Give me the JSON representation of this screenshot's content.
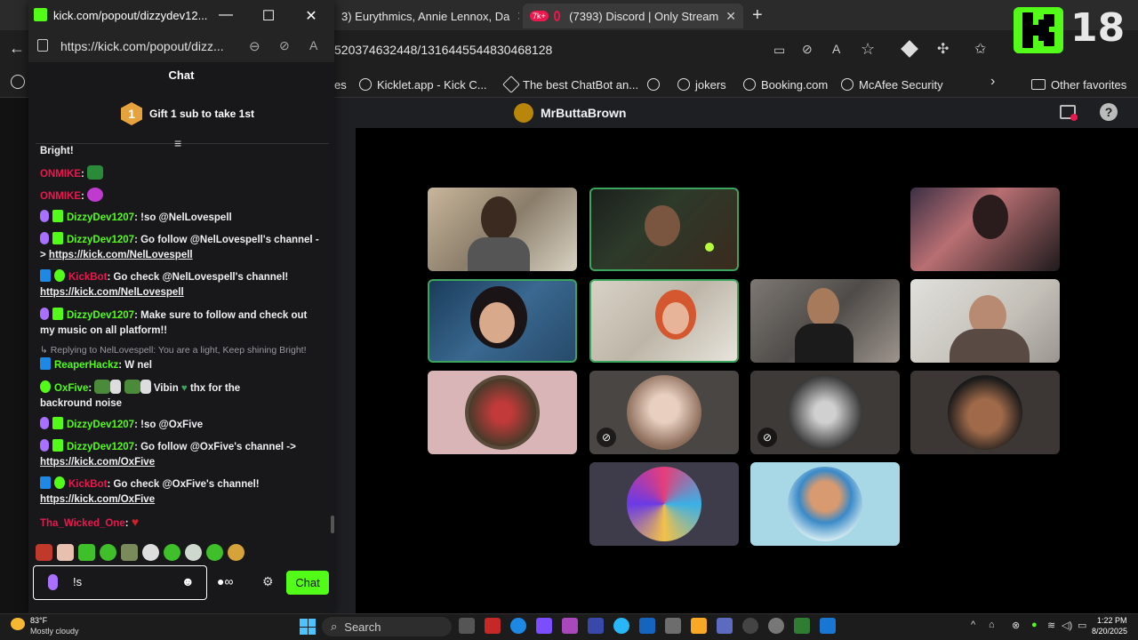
{
  "bg_browser": {
    "tabs": [
      {
        "label": "3) Eurythmics, Annie Lennox, Da"
      },
      {
        "label": "(7393) Discord | Only Stream",
        "badge": "7k+"
      }
    ],
    "url": "520374632448/1316445544830468128",
    "bookmarks": [
      "es",
      "Kicklet.app - Kick C...",
      "The best ChatBot an...",
      "jokers",
      "Booking.com",
      "McAfee Security"
    ],
    "other_favorites": "Other favorites"
  },
  "discord": {
    "channel_name": "MrButtaBrown"
  },
  "overlay": {
    "age_rating": "18"
  },
  "popout": {
    "window_title": "kick.com/popout/dizzydev12...",
    "url": "https://kick.com/popout/dizz...",
    "chat_title": "Chat",
    "gift_badge": "1",
    "gift_text": "Gift 1 sub to take 1st",
    "messages": [
      {
        "user": "",
        "text": "Bright!"
      },
      {
        "user": "ONMIKE",
        "sep": ":"
      },
      {
        "user": "ONMIKE",
        "sep": ":"
      },
      {
        "user": "DizzyDev1207",
        "sep": ":",
        "text": " !so @NelLovespell"
      },
      {
        "user": "DizzyDev1207",
        "sep": ":",
        "text": " Go follow @NelLovespell's channel -",
        "text2": "> ",
        "link": "https://kick.com/NelLovespell"
      },
      {
        "user": "KickBot",
        "sep": ":",
        "text": " Go check @NelLovespell's channel!",
        "link": "https://kick.com/NelLovespell"
      },
      {
        "user": "DizzyDev1207",
        "sep": ":",
        "text": " Make sure to follow and check out",
        "text2": "my music on all platform!!"
      },
      {
        "reply": "Replying to NelLovespell: You are a light, Keep shining Bright!"
      },
      {
        "user": "ReaperHackz",
        "sep": ":",
        "text": " W nel"
      },
      {
        "user": "OxFive",
        "sep": ":",
        "text": " Vibin",
        "text2": " thx for the",
        "text3": "backround noise"
      },
      {
        "user": "DizzyDev1207",
        "sep": ":",
        "text": " !so @OxFive"
      },
      {
        "user": "DizzyDev1207",
        "sep": ":",
        "text": " Go follow @OxFive's channel ->",
        "link": "https://kick.com/OxFive"
      },
      {
        "user": "KickBot",
        "sep": ":",
        "text": " Go check @OxFive's channel!",
        "link": "https://kick.com/OxFive"
      },
      {
        "user": "Tha_Wicked_One",
        "sep": ":"
      }
    ],
    "input_value": "!s",
    "send_label": "Chat"
  },
  "taskbar": {
    "weather_temp": "83°F",
    "weather_desc": "Mostly cloudy",
    "search_label": "Search",
    "time": "1:22 PM",
    "date": "8/20/2025"
  },
  "colors": {
    "kick_green": "#53fc18",
    "username_red": "#e9194e",
    "username_green": "#53fc18",
    "kickbot_red": "#e9194e",
    "speaking_border": "#3ba55d"
  }
}
